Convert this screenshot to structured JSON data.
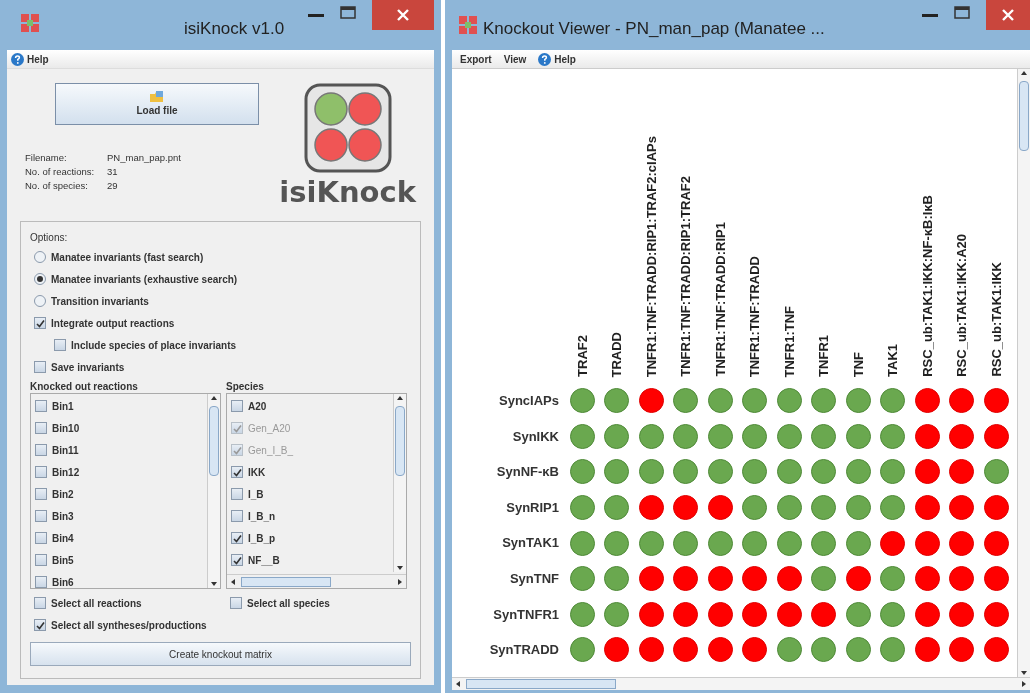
{
  "main_window": {
    "title": "isiKnock v1.0",
    "menu": [
      {
        "label": "Help",
        "kind": "help"
      }
    ],
    "load_button": "Load file",
    "logo_text": "isiKnock",
    "info": [
      {
        "label": "Filename:",
        "value": "PN_man_pap.pnt"
      },
      {
        "label": "No. of reactions:",
        "value": "31"
      },
      {
        "label": "No. of species:",
        "value": "29"
      }
    ],
    "options": {
      "title": "Options:",
      "modes": [
        {
          "label": "Manatee invariants (fast search)",
          "selected": false
        },
        {
          "label": "Manatee invariants (exhaustive search)",
          "selected": true
        },
        {
          "label": "Transition invariants",
          "selected": false
        }
      ],
      "checks": [
        {
          "label": "Integrate output reactions",
          "checked": true,
          "children": [
            {
              "label": "Include species of place invariants",
              "checked": false
            }
          ]
        },
        {
          "label": "Save invariants",
          "checked": false
        }
      ]
    },
    "reactions": {
      "title": "Knocked out reactions",
      "items": [
        {
          "label": "Bin1",
          "checked": false
        },
        {
          "label": "Bin10",
          "checked": false
        },
        {
          "label": "Bin11",
          "checked": false
        },
        {
          "label": "Bin12",
          "checked": false
        },
        {
          "label": "Bin2",
          "checked": false
        },
        {
          "label": "Bin3",
          "checked": false
        },
        {
          "label": "Bin4",
          "checked": false
        },
        {
          "label": "Bin5",
          "checked": false
        },
        {
          "label": "Bin6",
          "checked": false
        }
      ]
    },
    "species": {
      "title": "Species",
      "items": [
        {
          "label": "A20",
          "checked": false,
          "disabled": false
        },
        {
          "label": "Gen_A20",
          "checked": true,
          "disabled": true
        },
        {
          "label": "Gen_I_B_",
          "checked": true,
          "disabled": true
        },
        {
          "label": "IKK",
          "checked": true,
          "disabled": false
        },
        {
          "label": "I_B",
          "checked": false,
          "disabled": false
        },
        {
          "label": "I_B_n",
          "checked": false,
          "disabled": false
        },
        {
          "label": "I_B_p",
          "checked": true,
          "disabled": false
        },
        {
          "label": "NF__B",
          "checked": true,
          "disabled": false
        }
      ]
    },
    "select_all": [
      {
        "label": "Select all reactions",
        "checked": false
      },
      {
        "label": "Select all species",
        "checked": false
      },
      {
        "label": "Select all syntheses/productions",
        "checked": true
      }
    ],
    "create_button": "Create knockout matrix"
  },
  "viewer": {
    "title": "Knockout Viewer - PN_man_pap (Manatee ...",
    "menu": [
      {
        "label": "Export",
        "kind": "plain"
      },
      {
        "label": "View",
        "kind": "plain"
      },
      {
        "label": "Help",
        "kind": "help"
      }
    ],
    "matrix": {
      "columns": [
        "TRAF2",
        "TRADD",
        "TNFR1:TNF:TRADD:RIP1:TRAF2:cIAPs",
        "TNFR1:TNF:TRADD:RIP1:TRAF2",
        "TNFR1:TNF:TRADD:RIP1",
        "TNFR1:TNF:TRADD",
        "TNFR1:TNF",
        "TNFR1",
        "TNF",
        "TAK1",
        "RSC_ub:TAK1:IKK:NF-κB:IκB",
        "RSC_ub:TAK1:IKK:A20",
        "RSC_ub:TAK1:IKK"
      ],
      "rows": [
        {
          "label": "SyncIAPs",
          "knocked_out": [
            false,
            false,
            true,
            false,
            false,
            false,
            false,
            false,
            false,
            false,
            true,
            true,
            true
          ]
        },
        {
          "label": "SynIKK",
          "knocked_out": [
            false,
            false,
            false,
            false,
            false,
            false,
            false,
            false,
            false,
            false,
            true,
            true,
            true
          ]
        },
        {
          "label": "SynNF-κB",
          "knocked_out": [
            false,
            false,
            false,
            false,
            false,
            false,
            false,
            false,
            false,
            false,
            true,
            true,
            false
          ]
        },
        {
          "label": "SynRIP1",
          "knocked_out": [
            false,
            false,
            true,
            true,
            true,
            false,
            false,
            false,
            false,
            false,
            true,
            true,
            true
          ]
        },
        {
          "label": "SynTAK1",
          "knocked_out": [
            false,
            false,
            false,
            false,
            false,
            false,
            false,
            false,
            false,
            true,
            true,
            true,
            true
          ]
        },
        {
          "label": "SynTNF",
          "knocked_out": [
            false,
            false,
            true,
            true,
            true,
            true,
            true,
            false,
            true,
            false,
            true,
            true,
            true
          ]
        },
        {
          "label": "SynTNFR1",
          "knocked_out": [
            false,
            false,
            true,
            true,
            true,
            true,
            true,
            true,
            false,
            false,
            true,
            true,
            true
          ]
        },
        {
          "label": "SynTRADD",
          "knocked_out": [
            false,
            true,
            true,
            true,
            true,
            true,
            false,
            false,
            false,
            false,
            true,
            true,
            true
          ]
        }
      ]
    }
  }
}
